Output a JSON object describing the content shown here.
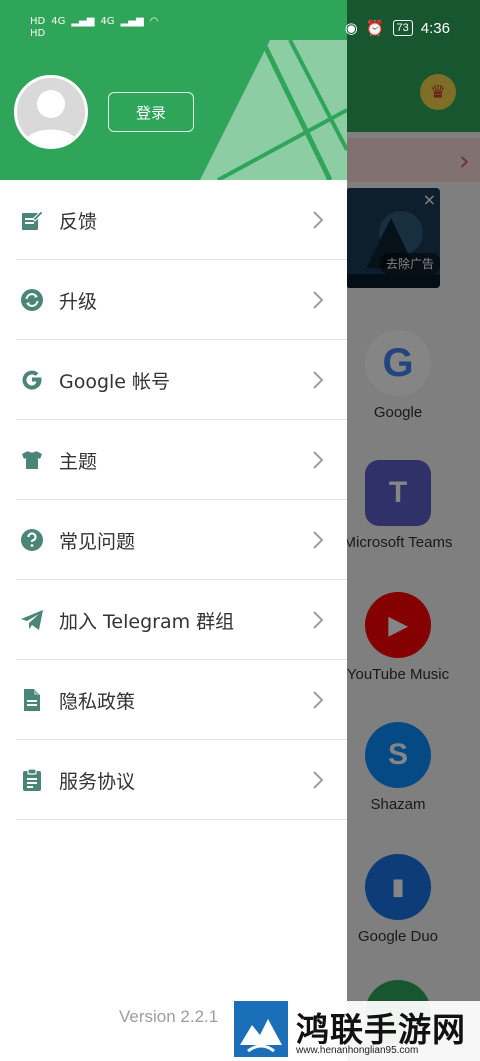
{
  "status_bar": {
    "time": "4:36",
    "battery": "73",
    "signal_left": [
      "HD",
      "4G",
      "4G"
    ],
    "icons": [
      "eye-icon",
      "alarm-icon",
      "battery-icon",
      "wifi-icon"
    ]
  },
  "drawer": {
    "login_label": "登录",
    "menu": [
      {
        "label": "反馈",
        "icon": "feedback-edit-icon"
      },
      {
        "label": "升级",
        "icon": "refresh-icon"
      },
      {
        "label": "Google 帐号",
        "icon": "google-g-icon"
      },
      {
        "label": "主题",
        "icon": "tshirt-icon"
      },
      {
        "label": "常见问题",
        "icon": "question-icon"
      },
      {
        "label": "加入 Telegram 群组",
        "icon": "telegram-plane-icon"
      },
      {
        "label": "隐私政策",
        "icon": "document-icon"
      },
      {
        "label": "服务协议",
        "icon": "clipboard-icon"
      }
    ],
    "version": "Version 2.2.1"
  },
  "background_app": {
    "ad_remove_label": "去除广告",
    "apps": [
      {
        "name": "Google",
        "color": "#ffffff",
        "glyph": "G"
      },
      {
        "name": "Microsoft Teams",
        "color": "#5b5fc7",
        "glyph": "T"
      },
      {
        "name": "YouTube Music",
        "color": "#ff0000",
        "glyph": "▶"
      },
      {
        "name": "Shazam",
        "color": "#0a8dff",
        "glyph": "S"
      },
      {
        "name": "Google Duo",
        "color": "#1a73e8",
        "glyph": "▮"
      }
    ]
  },
  "watermark": {
    "title": "鸿联手游网",
    "url": "www.henanhonglian95.com"
  },
  "colors": {
    "brand_green": "#2fa55a",
    "icon_teal": "#4a8577"
  }
}
